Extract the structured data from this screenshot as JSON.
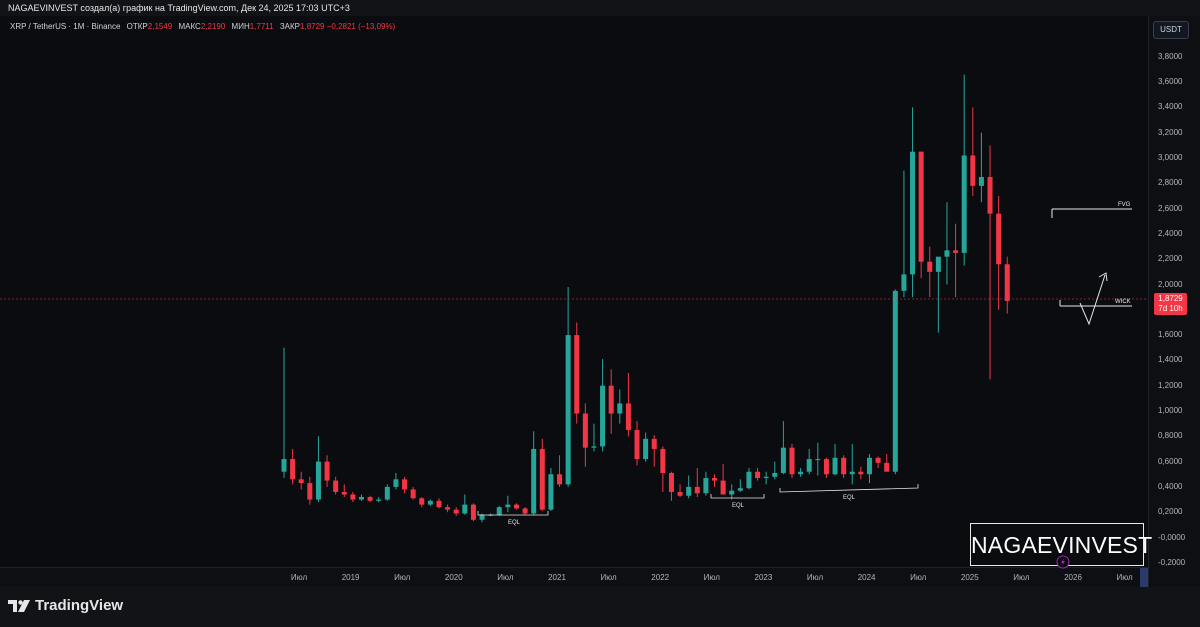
{
  "header": {
    "attribution": "NAGAEVINVEST создал(а) график на TradingView.com, Дек 24, 2025 17:03 UTC+3"
  },
  "legend": {
    "symbol": "XRP / TetherUS · 1M · Binance",
    "open_label": "ОТКР",
    "open_value": "2,1549",
    "high_label": "МАКС",
    "high_value": "2,2190",
    "low_label": "МИН",
    "low_value": "1,7711",
    "close_label": "ЗАКР",
    "close_value": "1,8729",
    "change": "−0,2821 (−13,09%)"
  },
  "currency": "USDT",
  "price_ticks": [
    "3,8000",
    "3,6000",
    "3,4000",
    "3,2000",
    "3,0000",
    "2,8000",
    "2,6000",
    "2,4000",
    "2,2000",
    "2,0000",
    "1,6000",
    "1,4000",
    "1,2000",
    "1,0000",
    "0,8000",
    "0,6000",
    "0,4000",
    "0,2000",
    "-0,0000",
    "-0,2000"
  ],
  "time_ticks": [
    "Июл",
    "2019",
    "Июл",
    "2020",
    "Июл",
    "2021",
    "Июл",
    "2022",
    "Июл",
    "2023",
    "Июл",
    "2024",
    "Июл",
    "2025",
    "Июл",
    "2026",
    "Июл"
  ],
  "price_tag": {
    "price": "1,8729",
    "countdown": "7d 10h"
  },
  "annotations": {
    "fvg": "FVG",
    "wick": "WICK",
    "eql": "EQL"
  },
  "watermark": "NAGAEVINVEST",
  "footer": {
    "brand": "TradingView"
  },
  "colors": {
    "up": "#26a69a",
    "down": "#f23645",
    "background": "#0b0c10",
    "axis_text": "#b2b5be"
  },
  "chart_data": {
    "type": "candlestick",
    "ylim": [
      -0.2,
      3.8
    ],
    "series": [
      {
        "name": "XRP / TetherUS",
        "ohlc": [
          [
            0.52,
            1.5,
            0.47,
            0.62
          ],
          [
            0.62,
            0.7,
            0.42,
            0.46
          ],
          [
            0.46,
            0.52,
            0.38,
            0.43
          ],
          [
            0.43,
            0.48,
            0.26,
            0.3
          ],
          [
            0.3,
            0.8,
            0.28,
            0.6
          ],
          [
            0.6,
            0.65,
            0.4,
            0.45
          ],
          [
            0.45,
            0.48,
            0.34,
            0.36
          ],
          [
            0.36,
            0.42,
            0.32,
            0.34
          ],
          [
            0.34,
            0.36,
            0.28,
            0.3
          ],
          [
            0.3,
            0.34,
            0.29,
            0.32
          ],
          [
            0.32,
            0.33,
            0.28,
            0.29
          ],
          [
            0.29,
            0.32,
            0.28,
            0.3
          ],
          [
            0.3,
            0.42,
            0.29,
            0.4
          ],
          [
            0.4,
            0.51,
            0.38,
            0.46
          ],
          [
            0.46,
            0.48,
            0.35,
            0.38
          ],
          [
            0.38,
            0.4,
            0.3,
            0.31
          ],
          [
            0.31,
            0.32,
            0.24,
            0.26
          ],
          [
            0.26,
            0.3,
            0.25,
            0.29
          ],
          [
            0.29,
            0.31,
            0.23,
            0.24
          ],
          [
            0.24,
            0.26,
            0.2,
            0.22
          ],
          [
            0.22,
            0.24,
            0.17,
            0.19
          ],
          [
            0.19,
            0.34,
            0.18,
            0.26
          ],
          [
            0.26,
            0.27,
            0.13,
            0.14
          ],
          [
            0.14,
            0.19,
            0.12,
            0.18
          ],
          [
            0.18,
            0.19,
            0.17,
            0.18
          ],
          [
            0.18,
            0.25,
            0.17,
            0.24
          ],
          [
            0.24,
            0.33,
            0.2,
            0.26
          ],
          [
            0.26,
            0.27,
            0.22,
            0.23
          ],
          [
            0.23,
            0.24,
            0.18,
            0.19
          ],
          [
            0.19,
            0.84,
            0.18,
            0.7
          ],
          [
            0.7,
            0.78,
            0.21,
            0.22
          ],
          [
            0.22,
            0.55,
            0.21,
            0.5
          ],
          [
            0.5,
            0.65,
            0.4,
            0.42
          ],
          [
            0.42,
            1.98,
            0.4,
            1.6
          ],
          [
            1.6,
            1.7,
            0.9,
            0.98
          ],
          [
            0.98,
            1.06,
            0.56,
            0.71
          ],
          [
            0.71,
            0.9,
            0.68,
            0.72
          ],
          [
            0.72,
            1.41,
            0.68,
            1.2
          ],
          [
            1.2,
            1.33,
            0.82,
            0.98
          ],
          [
            0.98,
            1.17,
            0.9,
            1.06
          ],
          [
            1.06,
            1.3,
            0.8,
            0.85
          ],
          [
            0.85,
            0.92,
            0.57,
            0.62
          ],
          [
            0.62,
            0.83,
            0.6,
            0.78
          ],
          [
            0.78,
            0.81,
            0.56,
            0.7
          ],
          [
            0.7,
            0.72,
            0.36,
            0.51
          ],
          [
            0.51,
            0.52,
            0.29,
            0.36
          ],
          [
            0.36,
            0.42,
            0.32,
            0.33
          ],
          [
            0.33,
            0.49,
            0.31,
            0.4
          ],
          [
            0.4,
            0.55,
            0.32,
            0.35
          ],
          [
            0.35,
            0.52,
            0.33,
            0.47
          ],
          [
            0.47,
            0.5,
            0.4,
            0.45
          ],
          [
            0.45,
            0.58,
            0.39,
            0.34
          ],
          [
            0.34,
            0.42,
            0.3,
            0.37
          ],
          [
            0.37,
            0.46,
            0.36,
            0.39
          ],
          [
            0.39,
            0.55,
            0.38,
            0.52
          ],
          [
            0.52,
            0.55,
            0.45,
            0.47
          ],
          [
            0.47,
            0.52,
            0.42,
            0.48
          ],
          [
            0.48,
            0.6,
            0.46,
            0.51
          ],
          [
            0.51,
            0.92,
            0.5,
            0.71
          ],
          [
            0.71,
            0.74,
            0.47,
            0.5
          ],
          [
            0.5,
            0.55,
            0.48,
            0.52
          ],
          [
            0.52,
            0.7,
            0.5,
            0.62
          ],
          [
            0.62,
            0.75,
            0.49,
            0.62
          ],
          [
            0.62,
            0.63,
            0.47,
            0.5
          ],
          [
            0.5,
            0.74,
            0.49,
            0.63
          ],
          [
            0.63,
            0.65,
            0.47,
            0.5
          ],
          [
            0.5,
            0.74,
            0.42,
            0.52
          ],
          [
            0.52,
            0.56,
            0.46,
            0.5
          ],
          [
            0.5,
            0.66,
            0.43,
            0.63
          ],
          [
            0.63,
            0.64,
            0.55,
            0.59
          ],
          [
            0.59,
            0.66,
            0.55,
            0.52
          ],
          [
            0.52,
            1.96,
            0.5,
            1.95
          ],
          [
            1.95,
            2.9,
            1.9,
            2.08
          ],
          [
            2.08,
            3.4,
            1.9,
            3.05
          ],
          [
            3.05,
            3.05,
            2.05,
            2.18
          ],
          [
            2.18,
            2.3,
            1.9,
            2.1
          ],
          [
            2.1,
            2.2,
            1.62,
            2.22
          ],
          [
            2.22,
            2.65,
            2.0,
            2.27
          ],
          [
            2.27,
            2.48,
            1.9,
            2.25
          ],
          [
            2.25,
            3.66,
            2.15,
            3.02
          ],
          [
            3.02,
            3.4,
            2.7,
            2.78
          ],
          [
            2.78,
            3.2,
            2.65,
            2.85
          ],
          [
            2.85,
            3.1,
            1.25,
            2.56
          ],
          [
            2.56,
            2.7,
            1.8,
            2.16
          ],
          [
            2.16,
            2.22,
            1.77,
            1.87
          ]
        ]
      }
    ]
  }
}
